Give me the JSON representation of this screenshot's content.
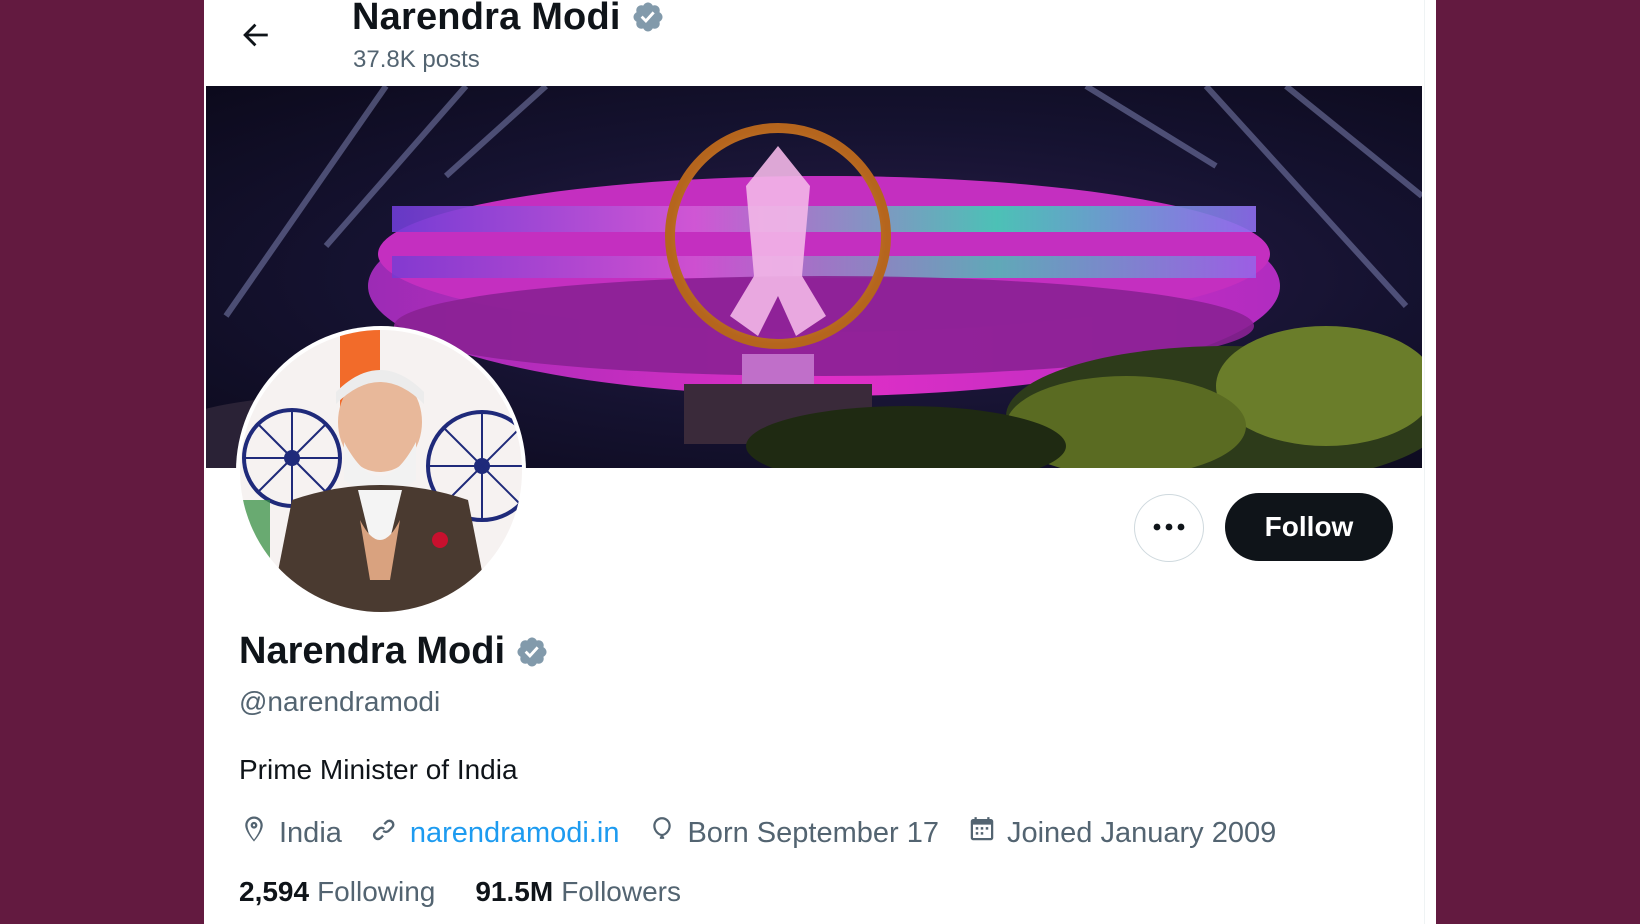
{
  "header": {
    "title": "Narendra Modi",
    "posts_count": "37.8K posts"
  },
  "profile": {
    "name": "Narendra Modi",
    "handle": "@narendramodi",
    "bio": "Prime Minister of India",
    "location": "India",
    "website": "narendramodi.in",
    "birthday": "Born September 17",
    "joined": "Joined January 2009",
    "following_count": "2,594",
    "following_label": "Following",
    "followers_count": "91.5M",
    "followers_label": "Followers"
  },
  "actions": {
    "follow_label": "Follow",
    "more_icon": "ellipsis-icon"
  },
  "colors": {
    "background": "#631a40",
    "verified": "#829aab",
    "link": "#1d9bf0",
    "follow_button": "#0f1419"
  }
}
